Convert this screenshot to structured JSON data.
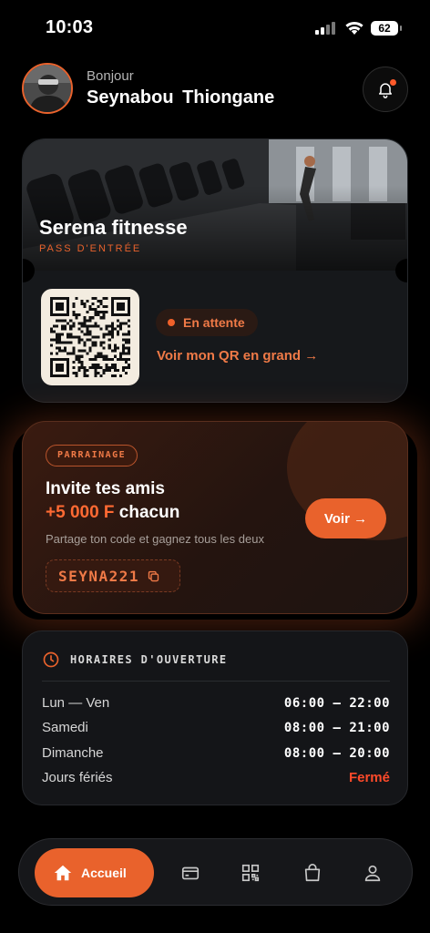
{
  "status_bar": {
    "time": "10:03",
    "battery": "62"
  },
  "header": {
    "greeting": "Bonjour",
    "user_name": "Seynabou Thiongane"
  },
  "pass_card": {
    "gym_name": "Serena fitnesse",
    "subtitle": "PASS D'ENTRÉE",
    "status": "En attente",
    "qr_link": "Voir mon QR en grand →"
  },
  "referral": {
    "badge": "PARRAINAGE",
    "line1": "Invite tes amis",
    "amount": "+5 000 F",
    "amount_suffix": " chacun",
    "note": "Partage ton code et gagnez tous les deux",
    "code": "SEYNA221",
    "button": "Voir →"
  },
  "hours": {
    "title": "HORAIRES D'OUVERTURE",
    "rows": [
      {
        "day": "Lun — Ven",
        "value": "06:00 — 22:00"
      },
      {
        "day": "Samedi",
        "value": "08:00 — 21:00"
      },
      {
        "day": "Dimanche",
        "value": "08:00 — 20:00"
      },
      {
        "day": "Jours fériés",
        "value": "Fermé"
      }
    ]
  },
  "tabbar": {
    "home_label": "Accueil"
  },
  "colors": {
    "accent": "#e9622c",
    "closed": "#ff4a2a",
    "background": "#000000"
  }
}
